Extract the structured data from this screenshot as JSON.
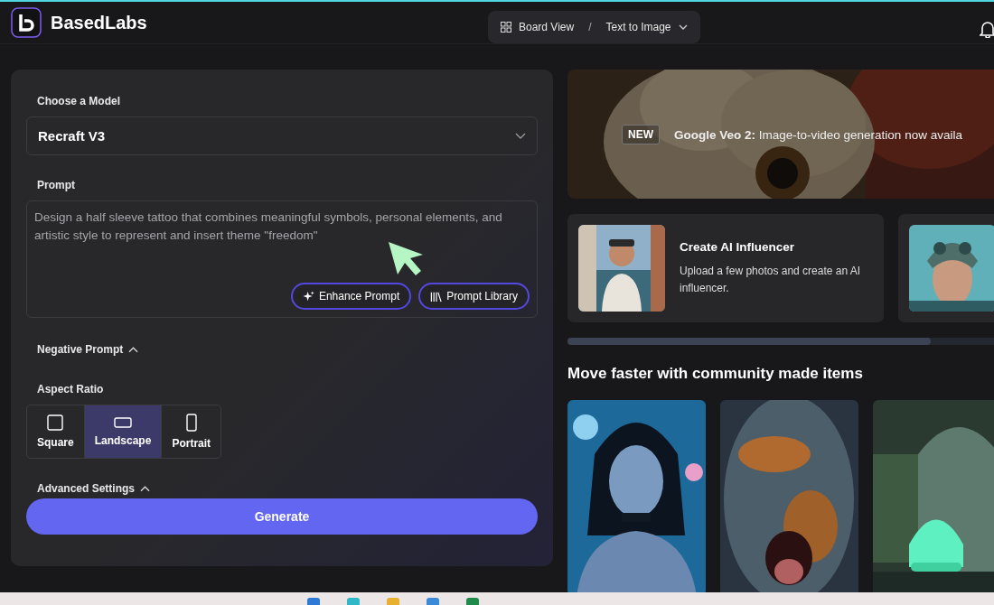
{
  "header": {
    "brand": "BasedLabs",
    "breadcrumb": [
      {
        "label": "Board View"
      },
      {
        "label": "/"
      },
      {
        "label": "Text to Image"
      }
    ]
  },
  "form": {
    "model": {
      "label": "Choose a Model",
      "value": "Recraft V3"
    },
    "prompt": {
      "label": "Prompt",
      "value": "Design a half sleeve tattoo that combines meaningful symbols, personal elements, and artistic style to represent and insert theme \"freedom\""
    },
    "prompt_buttons": [
      {
        "kind": "enhance",
        "label": "Enhance Prompt"
      },
      {
        "kind": "library",
        "label": "Prompt Library"
      }
    ],
    "negative_prompt": {
      "label": "Negative Prompt"
    },
    "aspect_ratio": {
      "label": "Aspect Ratio",
      "options": [
        {
          "kind": "square",
          "label": "Square",
          "selected": false
        },
        {
          "kind": "landscape",
          "label": "Landscape",
          "selected": true
        },
        {
          "kind": "portrait",
          "label": "Portrait",
          "selected": false
        }
      ]
    },
    "advanced_settings": {
      "label": "Advanced Settings"
    },
    "generate": "Generate"
  },
  "banner": {
    "badge": "NEW",
    "title": "Google Veo 2:",
    "text": "Image-to-video generation now availa"
  },
  "cards": [
    {
      "kind": "feature",
      "title": "Create AI Influencer",
      "text": "Upload a few photos and create an AI influencer."
    },
    {
      "kind": "picture"
    }
  ],
  "community": {
    "heading": "Move faster with community made items",
    "items": [
      {
        "kind": "picture"
      },
      {
        "kind": "picture"
      },
      {
        "kind": "picture"
      }
    ]
  }
}
